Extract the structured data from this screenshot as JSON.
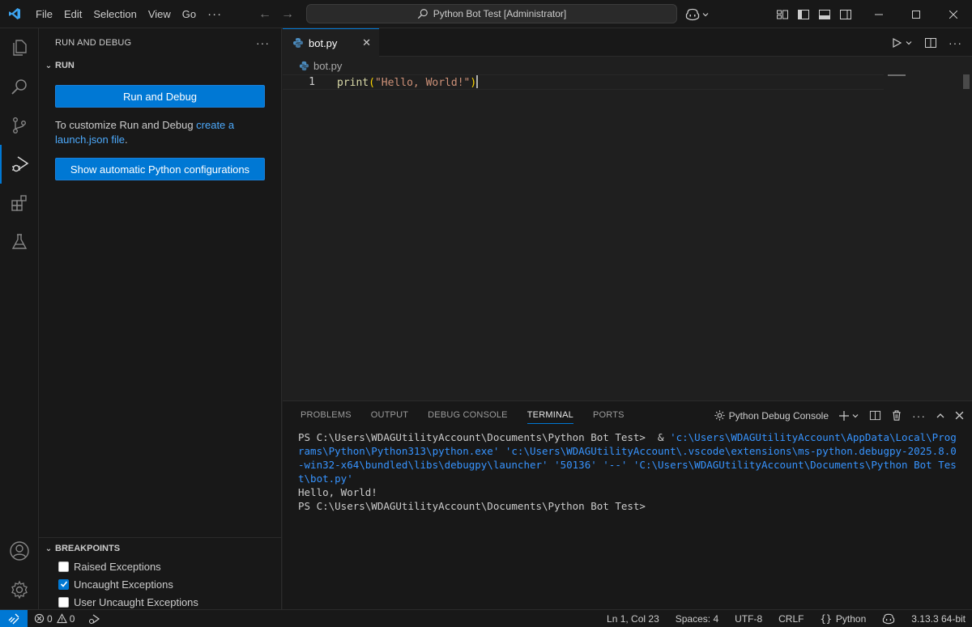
{
  "titlebar": {
    "menu": [
      "File",
      "Edit",
      "Selection",
      "View",
      "Go"
    ],
    "more": "···",
    "command_center": "Python Bot Test [Administrator]"
  },
  "sidebar": {
    "title": "RUN AND DEBUG",
    "more": "···",
    "section_run": "RUN",
    "run_button": "Run and Debug",
    "customize_text": "To customize Run and Debug ",
    "customize_link": "create a launch.json file",
    "customize_end": ".",
    "show_config_button": "Show automatic Python configurations",
    "breakpoints": {
      "title": "BREAKPOINTS",
      "items": [
        {
          "label": "Raised Exceptions",
          "checked": false
        },
        {
          "label": "Uncaught Exceptions",
          "checked": true
        },
        {
          "label": "User Uncaught Exceptions",
          "checked": false
        }
      ]
    }
  },
  "editor": {
    "tab_label": "bot.py",
    "breadcrumb": "bot.py",
    "line_number": "1",
    "code": {
      "fn": "print",
      "open": "(",
      "str": "\"Hello, World!\"",
      "close": ")"
    }
  },
  "panel": {
    "tabs": [
      "PROBLEMS",
      "OUTPUT",
      "DEBUG CONSOLE",
      "TERMINAL",
      "PORTS"
    ],
    "active_tab": "TERMINAL",
    "terminal_name": "Python Debug Console",
    "terminal": {
      "prompt1": "PS C:\\Users\\WDAGUtilityAccount\\Documents\\Python Bot Test>  & ",
      "command": "'c:\\Users\\WDAGUtilityAccount\\AppData\\Local\\Programs\\Python\\Python313\\python.exe' 'c:\\Users\\WDAGUtilityAccount\\.vscode\\extensions\\ms-python.debugpy-2025.8.0-win32-x64\\bundled\\libs\\debugpy\\launcher' '50136' '--' 'C:\\Users\\WDAGUtilityAccount\\Documents\\Python Bot Test\\bot.py'",
      "output": "Hello, World!",
      "prompt2": "PS C:\\Users\\WDAGUtilityAccount\\Documents\\Python Bot Test>"
    }
  },
  "statusbar": {
    "errors": "0",
    "warnings": "0",
    "position": "Ln 1, Col 23",
    "spaces": "Spaces: 4",
    "encoding": "UTF-8",
    "eol": "CRLF",
    "language": "Python",
    "interpreter": "3.13.3 64-bit"
  },
  "colors": {
    "accent": "#0078d4",
    "background": "#1f1f1f",
    "sidebar": "#181818"
  }
}
